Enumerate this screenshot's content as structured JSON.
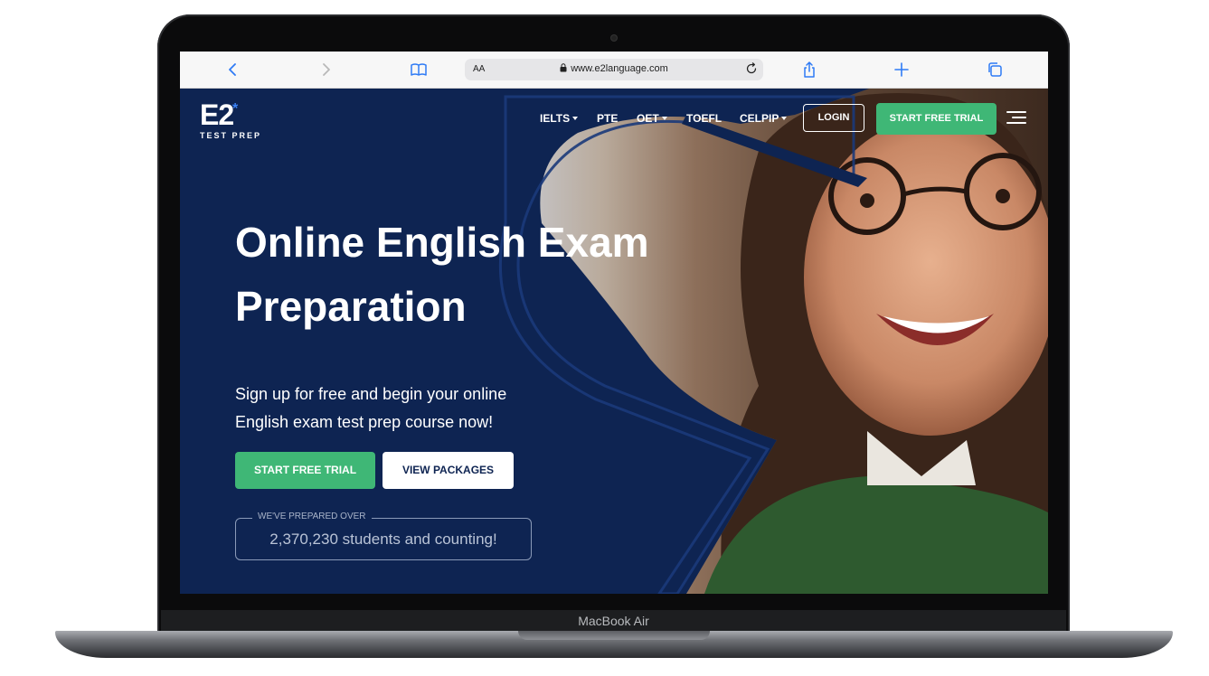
{
  "device": {
    "model_label": "MacBook Air"
  },
  "browser": {
    "aa_label": "AA",
    "url": "www.e2language.com"
  },
  "site": {
    "logo": {
      "mark": "E2",
      "star": "*",
      "subtitle": "TEST PREP"
    },
    "nav": {
      "items": [
        {
          "label": "IELTS",
          "has_caret": true
        },
        {
          "label": "PTE",
          "has_caret": false
        },
        {
          "label": "OET",
          "has_caret": true
        },
        {
          "label": "TOEFL",
          "has_caret": false
        },
        {
          "label": "CELPIP",
          "has_caret": true
        }
      ],
      "login_label": "LOGIN",
      "trial_label": "START FREE TRIAL"
    },
    "hero": {
      "title_line1": "Online English Exam",
      "title_line2": "Preparation",
      "subtitle_line1": "Sign up for free and begin your online",
      "subtitle_line2": "English exam test prep course now!",
      "primary_cta": "START FREE TRIAL",
      "secondary_cta": "VIEW PACKAGES",
      "counter_label": "WE'VE PREPARED OVER",
      "counter_value": "2,370,230 students and counting!"
    }
  },
  "colors": {
    "navy": "#0e2452",
    "green": "#3fb776",
    "accent_blue": "#3b82f6",
    "safari_blue": "#2f7bf5"
  }
}
